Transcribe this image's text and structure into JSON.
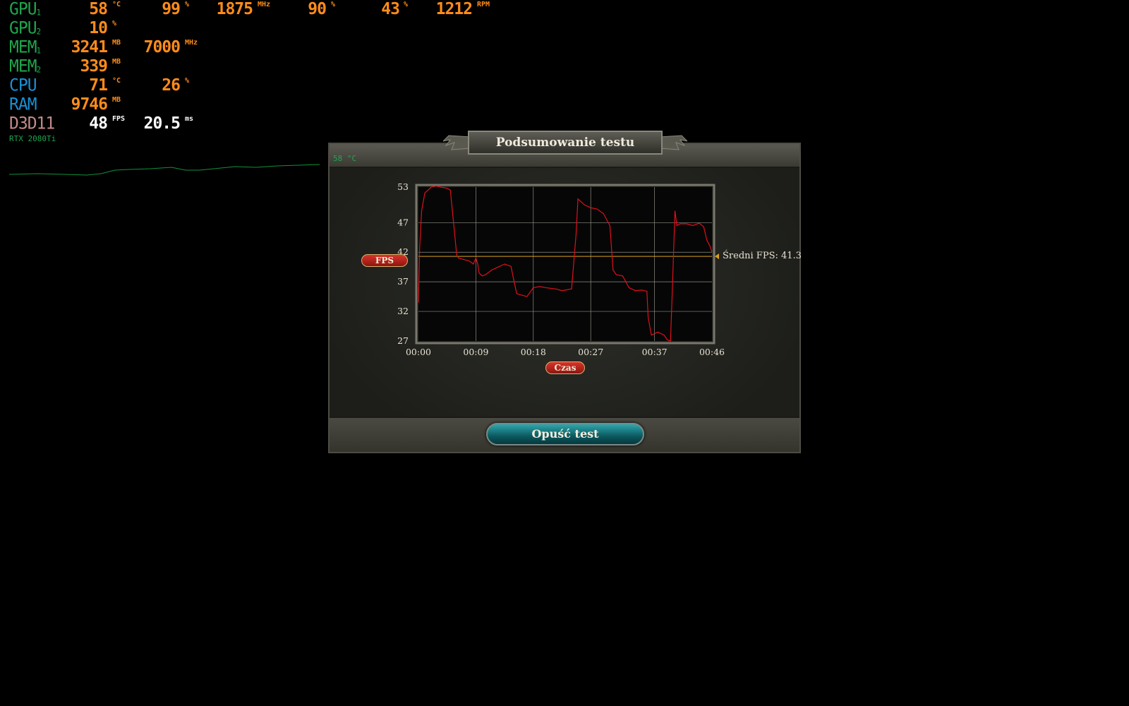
{
  "osd": {
    "rows": [
      {
        "label": "GPU",
        "sub": "1",
        "color": "green",
        "cells": [
          {
            "v": "58",
            "u": "°C"
          },
          {
            "v": "99",
            "u": "%"
          },
          {
            "v": "1875",
            "u": "MHz"
          },
          {
            "v": "90",
            "u": "%"
          },
          {
            "v": "43",
            "u": "%"
          },
          {
            "v": "1212",
            "u": "RPM"
          }
        ]
      },
      {
        "label": "GPU",
        "sub": "2",
        "color": "green",
        "cells": [
          {
            "v": "10",
            "u": "%"
          }
        ]
      },
      {
        "label": "MEM",
        "sub": "1",
        "color": "green",
        "cells": [
          {
            "v": "3241",
            "u": "MB"
          },
          {
            "v": "7000",
            "u": "MHz"
          }
        ]
      },
      {
        "label": "MEM",
        "sub": "2",
        "color": "green",
        "cells": [
          {
            "v": "339",
            "u": "MB"
          }
        ]
      },
      {
        "label": "CPU",
        "sub": "",
        "color": "blue",
        "cells": [
          {
            "v": "71",
            "u": "°C"
          },
          {
            "v": "26",
            "u": "%"
          }
        ]
      },
      {
        "label": "RAM",
        "sub": "",
        "color": "blue",
        "cells": [
          {
            "v": "9746",
            "u": "MB"
          }
        ]
      },
      {
        "label": "D3D11",
        "sub": "",
        "color": "pink",
        "cells": [
          {
            "v": "48",
            "u": "FPS",
            "white": true
          },
          {
            "v": "20.5",
            "u": "ms",
            "white": true
          }
        ]
      }
    ],
    "gpu_name": "RTX 2080Ti",
    "mini_temp": "58 °C"
  },
  "dialog": {
    "title": "Podsumowanie testu",
    "exit_button": "Opuść test",
    "avg_label": "Średni FPS: 41.3"
  },
  "chart_data": {
    "type": "line",
    "ylabel": "FPS",
    "xlabel": "Czas",
    "y_ticks": [
      "53",
      "47",
      "42",
      "37",
      "32",
      "27"
    ],
    "x_ticks": [
      "00:00",
      "00:09",
      "00:18",
      "00:27",
      "00:37",
      "00:46"
    ],
    "ylim": [
      27,
      53
    ],
    "xlim": [
      0,
      46
    ],
    "grid": true,
    "average": 41.3,
    "line_color": "#e0101a",
    "avg_color": "#d9a020",
    "series": [
      {
        "x": [
          0,
          0.2,
          0.5,
          1,
          2,
          2.8,
          3.5,
          4.5,
          5,
          5.5,
          6,
          6.3,
          7,
          8,
          8.6,
          9,
          9.3,
          9.5,
          10,
          10.5,
          11.5,
          12.5,
          13.5,
          14.5,
          15,
          15.4,
          16,
          17,
          18,
          19,
          20,
          21.5,
          22.5,
          24,
          24.7,
          25,
          25.5,
          26,
          27,
          28,
          29,
          29.5,
          30,
          30.5,
          31,
          32,
          33,
          34,
          35,
          35.8,
          36,
          36.5,
          37.5,
          38.5,
          39,
          39.5,
          39.8,
          40.2,
          40.5,
          41,
          42,
          43,
          44,
          44.7,
          45.2,
          45.7,
          46
        ],
        "y": [
          33.5,
          43,
          49,
          52,
          53,
          53.2,
          53,
          52.8,
          52.5,
          47,
          41.5,
          41,
          40.8,
          40.5,
          40,
          41,
          40,
          38.5,
          38,
          38.2,
          39,
          39.5,
          40,
          39.6,
          37,
          35,
          34.8,
          34.5,
          36,
          36.2,
          36,
          35.8,
          35.5,
          35.8,
          45,
          51,
          50.5,
          50,
          49.5,
          49.3,
          48.5,
          47.5,
          46.5,
          39,
          38.2,
          38,
          36,
          35.5,
          35.6,
          35.4,
          31,
          28,
          28.5,
          28,
          27.2,
          27,
          36,
          49,
          46.5,
          46.8,
          46.8,
          46.5,
          46.9,
          46.3,
          44,
          43,
          42
        ]
      }
    ]
  }
}
